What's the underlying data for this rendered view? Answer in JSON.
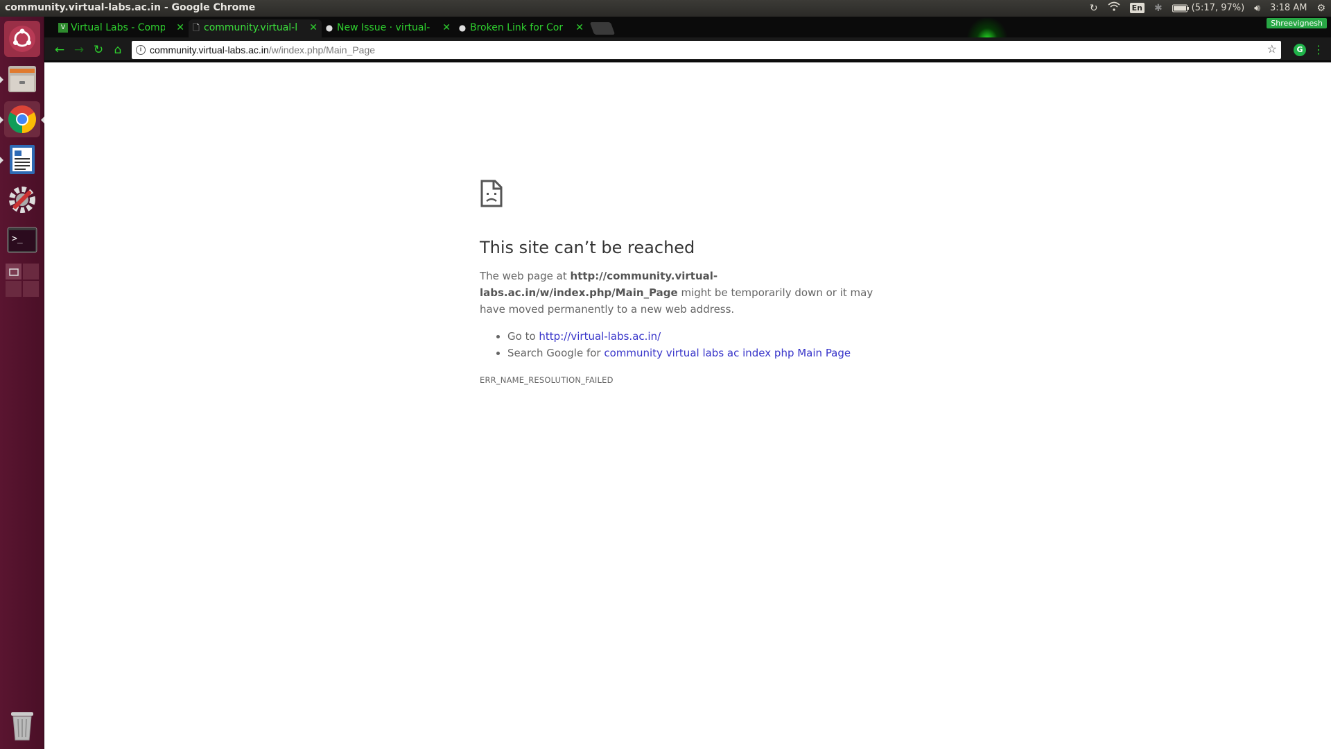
{
  "window": {
    "title": "community.virtual-labs.ac.in - Google Chrome"
  },
  "tray": {
    "keyboard": "En",
    "battery": "(5:17, 97%)",
    "time": "3:18 AM",
    "user": "Shreevignesh"
  },
  "launcher": {
    "items": [
      "ubuntu-dash",
      "files",
      "chrome",
      "libreoffice-writer",
      "system-settings",
      "terminal",
      "workspace-switcher",
      "trash"
    ]
  },
  "tabs": [
    {
      "title": "Virtual Labs - Comp",
      "favicon": "virtual-labs-favicon",
      "active": false
    },
    {
      "title": "community.virtual-l",
      "favicon": "page-icon",
      "active": true
    },
    {
      "title": "New Issue · virtual-",
      "favicon": "github-icon",
      "active": false
    },
    {
      "title": "Broken Link for Cor",
      "favicon": "github-icon",
      "active": false
    }
  ],
  "omnibox": {
    "host": "community.virtual-labs.ac.in",
    "path": "/w/index.php/Main_Page"
  },
  "error": {
    "heading": "This site can’t be reached",
    "para_pre": "The web page at ",
    "para_url": "http://community.virtual-labs.ac.in/w/index.php/Main_Page",
    "para_post": " might be temporarily down or it may have moved permanently to a new web address.",
    "goto_label": "Go to ",
    "goto_link": "http://virtual-labs.ac.in/",
    "search_label": "Search Google for ",
    "search_link": "community virtual labs ac index php Main Page",
    "code": "ERR_NAME_RESOLUTION_FAILED"
  },
  "colors": {
    "tab_text": "#2fd12f",
    "launcher_bg": "#5a1530",
    "link": "#3633c9"
  }
}
